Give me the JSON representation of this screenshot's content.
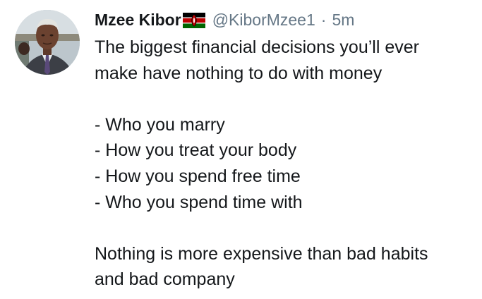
{
  "tweet": {
    "author": {
      "display_name": "Mzee Kibor",
      "flag_icon": "kenya-flag-icon",
      "handle": "@KiborMzee1",
      "separator": "·",
      "timestamp": "5m"
    },
    "body": {
      "intro_line1": "The biggest financial decisions you’ll ever",
      "intro_line2": "make have nothing to do with money",
      "list": [
        "- Who you marry",
        "- How you treat your body",
        "- How you spend free time",
        "- Who you spend time with"
      ],
      "outro_line1": "Nothing is more expensive than bad habits",
      "outro_line2": "and bad company"
    }
  },
  "colors": {
    "text_primary": "#14171a",
    "text_secondary": "#657786",
    "background": "#ffffff"
  }
}
